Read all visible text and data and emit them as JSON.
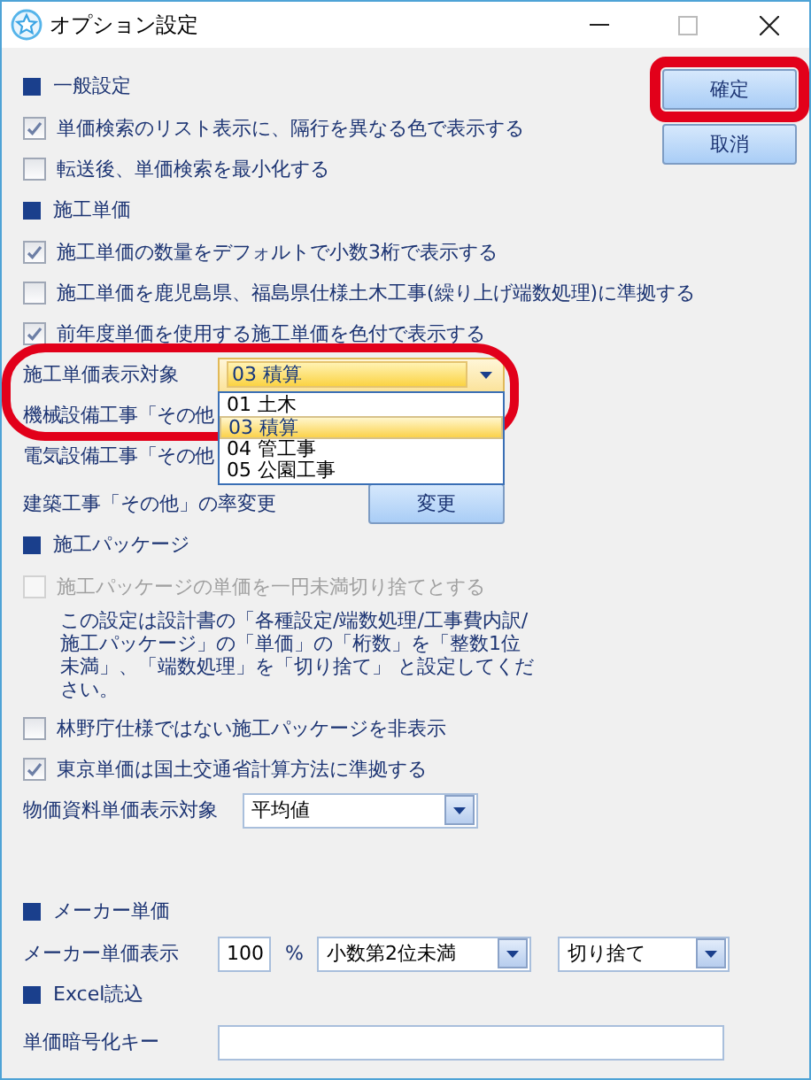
{
  "window": {
    "title": "オプション設定"
  },
  "buttons": [
    {
      "label": "確定",
      "highlighted": true
    },
    {
      "label": "取消",
      "highlighted": false
    }
  ],
  "sections": [
    {
      "title": "一般設定",
      "items": [
        {
          "kind": "checkbox",
          "label": "単価検索のリスト表示に、隔行を異なる色で表示する",
          "checked": true,
          "disabled": false
        },
        {
          "kind": "checkbox",
          "label": "転送後、単価検索を最小化する",
          "checked": false,
          "disabled": false
        }
      ]
    },
    {
      "title": "施工単価",
      "items": [
        {
          "kind": "checkbox",
          "label": "施工単価の数量をデフォルトで小数3桁で表示する",
          "checked": true,
          "disabled": false
        },
        {
          "kind": "checkbox",
          "label": "施工単価を鹿児島県、福島県仕様土木工事(繰り上げ端数処理)に準拠する",
          "checked": false,
          "disabled": false
        },
        {
          "kind": "checkbox",
          "label": "前年度単価を使用する施工単価を色付で表示する",
          "checked": true,
          "disabled": false
        },
        {
          "kind": "select",
          "label": "施工単価表示対象",
          "value": "03 積算",
          "expanded": true,
          "circled": true,
          "options": [
            {
              "label": "01 土木",
              "selected": false
            },
            {
              "label": "03 積算",
              "selected": true
            },
            {
              "label": "04 管工事",
              "selected": false
            },
            {
              "label": "05 公園工事",
              "selected": false
            }
          ]
        },
        {
          "kind": "label",
          "label": "機械設備工事「その他"
        },
        {
          "kind": "label",
          "label": "電気設備工事「その他"
        },
        {
          "kind": "button_row",
          "label": "建築工事「その他」の率変更",
          "button": "変更"
        }
      ]
    },
    {
      "title": "施工パッケージ",
      "items": [
        {
          "kind": "checkbox",
          "label": "施工パッケージの単価を一円未満切り捨てとする",
          "checked": false,
          "disabled": true
        },
        {
          "kind": "note",
          "text": "この設定は設計書の「各種設定/端数処理/工事費内訳/施工パッケージ」の「単価」の「桁数」を「整数1位未満」、「端数処理」を「切り捨て」 と設定してください。"
        },
        {
          "kind": "checkbox",
          "label": "林野庁仕様ではない施工パッケージを非表示",
          "checked": false,
          "disabled": false
        },
        {
          "kind": "checkbox",
          "label": "東京単価は国土交通省計算方法に準拠する",
          "checked": true,
          "disabled": false
        },
        {
          "kind": "select",
          "label": "物価資料単価表示対象",
          "value": "平均値",
          "expanded": false,
          "circled": false
        }
      ]
    },
    {
      "title": "メーカー単価",
      "items": [
        {
          "kind": "maker_row",
          "label": "メーカー単価表示",
          "percent": "100",
          "unit": "%",
          "rounding": "小数第2位未満",
          "method": "切り捨て"
        }
      ]
    },
    {
      "title": "Excel読込",
      "items": [
        {
          "kind": "text_input",
          "label": "単価暗号化キー"
        }
      ]
    }
  ]
}
